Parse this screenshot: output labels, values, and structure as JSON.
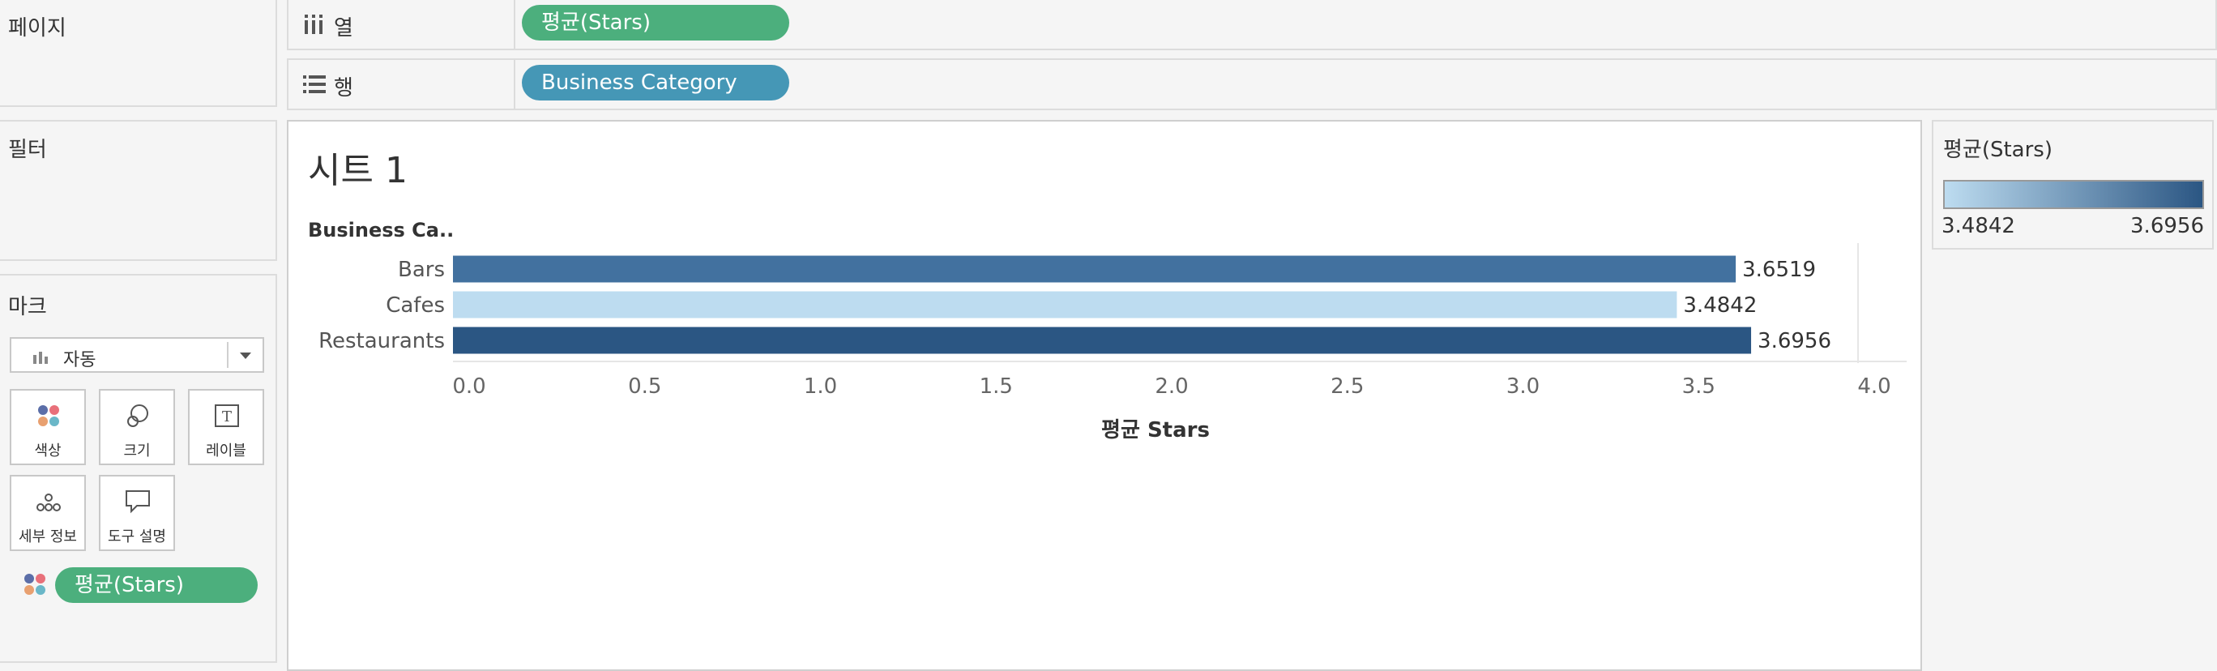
{
  "pages_panel": {
    "title": "페이지"
  },
  "filters_panel": {
    "title": "필터"
  },
  "marks_panel": {
    "title": "마크",
    "mark_type": "자동",
    "buttons": [
      {
        "label": "색상",
        "icon": "color-icon"
      },
      {
        "label": "크기",
        "icon": "size-icon"
      },
      {
        "label": "레이블",
        "icon": "label-icon"
      },
      {
        "label": "세부 정보",
        "icon": "detail-icon"
      },
      {
        "label": "도구 설명",
        "icon": "tooltip-icon"
      }
    ],
    "color_pill": "평균(Stars)"
  },
  "shelves": {
    "columns": {
      "label": "열",
      "pill": "평균(Stars)",
      "pill_color": "#4caf7d"
    },
    "rows": {
      "label": "행",
      "pill": "Business Category",
      "pill_color": "#4597b6"
    }
  },
  "sheet": {
    "title": "시트 1"
  },
  "legend": {
    "title": "평균(Stars)",
    "min_label": "3.4842",
    "max_label": "3.6956",
    "color_low": "#bddcf0",
    "color_high": "#2b5683"
  },
  "chart_data": {
    "type": "bar",
    "orientation": "horizontal",
    "row_header": "Business Ca..",
    "categories": [
      "Bars",
      "Cafes",
      "Restaurants"
    ],
    "values": [
      3.6519,
      3.4842,
      3.6956
    ],
    "value_labels": [
      "3.6519",
      "3.4842",
      "3.6956"
    ],
    "xlabel": "평균 Stars",
    "xlim": [
      0,
      4.0
    ],
    "xticks": [
      "0.0",
      "0.5",
      "1.0",
      "1.5",
      "2.0",
      "2.5",
      "3.0",
      "3.5",
      "4.0"
    ],
    "bar_colors": [
      "#42719f",
      "#bddcf0",
      "#2b5683"
    ],
    "grid": false
  }
}
